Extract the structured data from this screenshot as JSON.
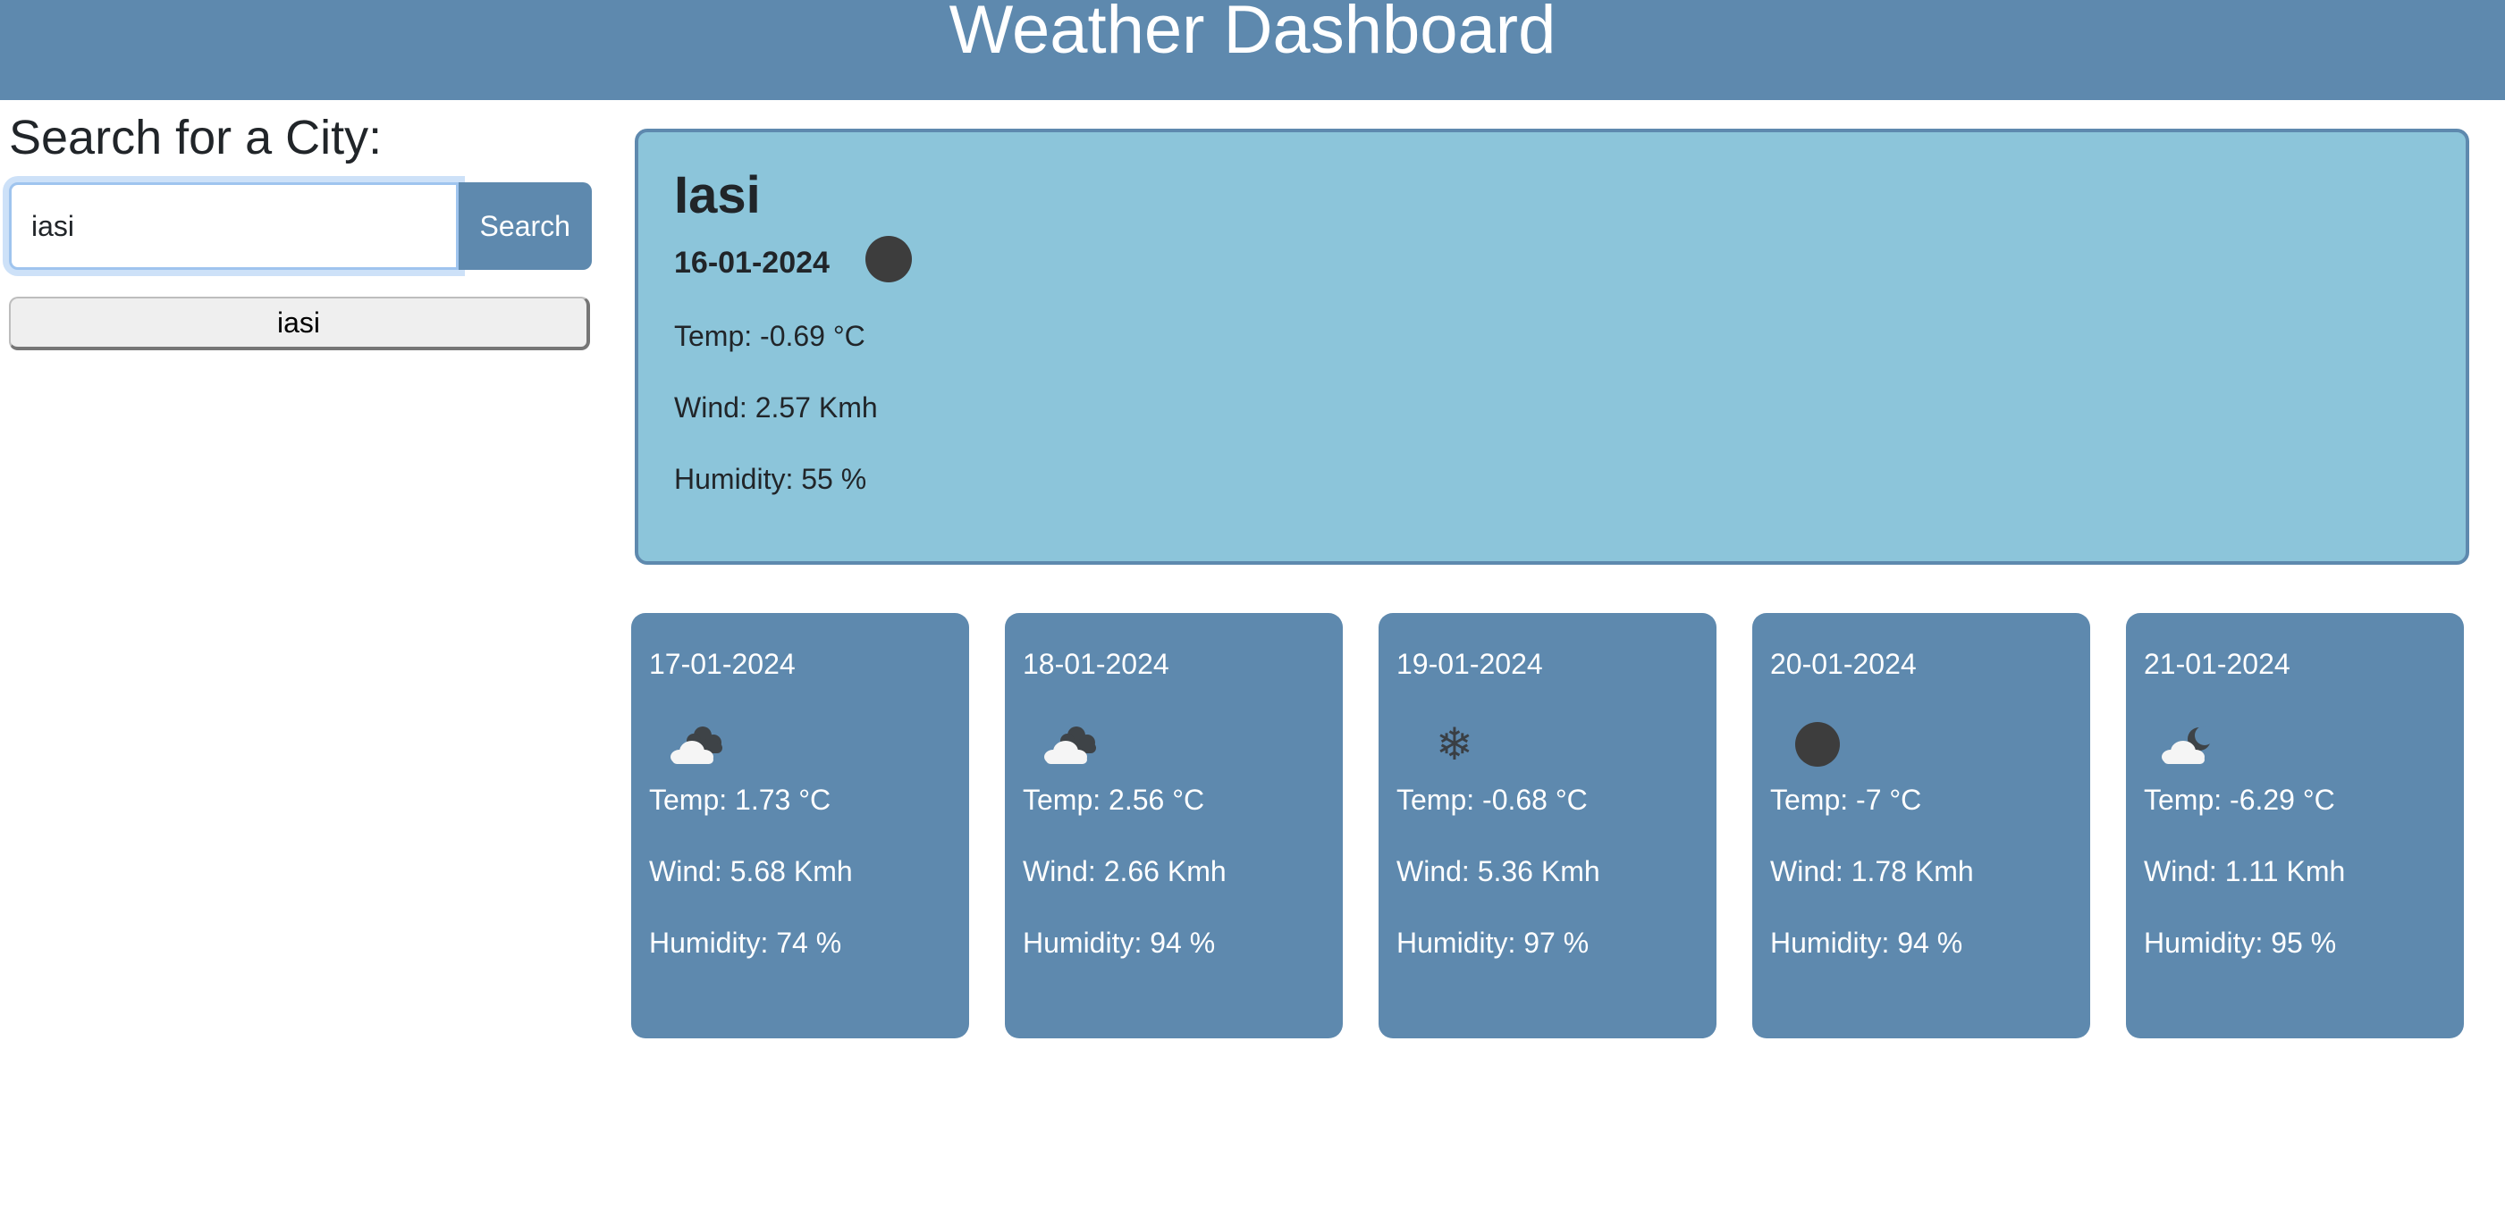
{
  "header": {
    "title": "Weather Dashboard"
  },
  "search": {
    "heading": "Search for a City:",
    "input_value": "iasi",
    "button_label": "Search",
    "history": [
      "iasi"
    ]
  },
  "current": {
    "city": "Iasi",
    "date": "16-01-2024",
    "icon": "clear-night-icon",
    "temp": "Temp: -0.69 °C",
    "wind": "Wind: 2.57 Kmh",
    "humidity": "Humidity: 55 %"
  },
  "forecast": [
    {
      "date": "17-01-2024",
      "icon": "cloudy-icon",
      "temp": "Temp: 1.73 °C",
      "wind": "Wind: 5.68 Kmh",
      "humidity": "Humidity: 74 %"
    },
    {
      "date": "18-01-2024",
      "icon": "cloudy-icon",
      "temp": "Temp: 2.56 °C",
      "wind": "Wind: 2.66 Kmh",
      "humidity": "Humidity: 94 %"
    },
    {
      "date": "19-01-2024",
      "icon": "snow-icon",
      "temp": "Temp: -0.68 °C",
      "wind": "Wind: 5.36 Kmh",
      "humidity": "Humidity: 97 %"
    },
    {
      "date": "20-01-2024",
      "icon": "clear-night-icon",
      "temp": "Temp: -7 °C",
      "wind": "Wind: 1.78 Kmh",
      "humidity": "Humidity: 94 %"
    },
    {
      "date": "21-01-2024",
      "icon": "partly-cloudy-night-icon",
      "temp": "Temp: -6.29 °C",
      "wind": "Wind: 1.11 Kmh",
      "humidity": "Humidity: 95 %"
    }
  ],
  "colors": {
    "header": "#5e89ae",
    "current_card": "#8cc5da",
    "forecast_card": "#5e89ae"
  }
}
